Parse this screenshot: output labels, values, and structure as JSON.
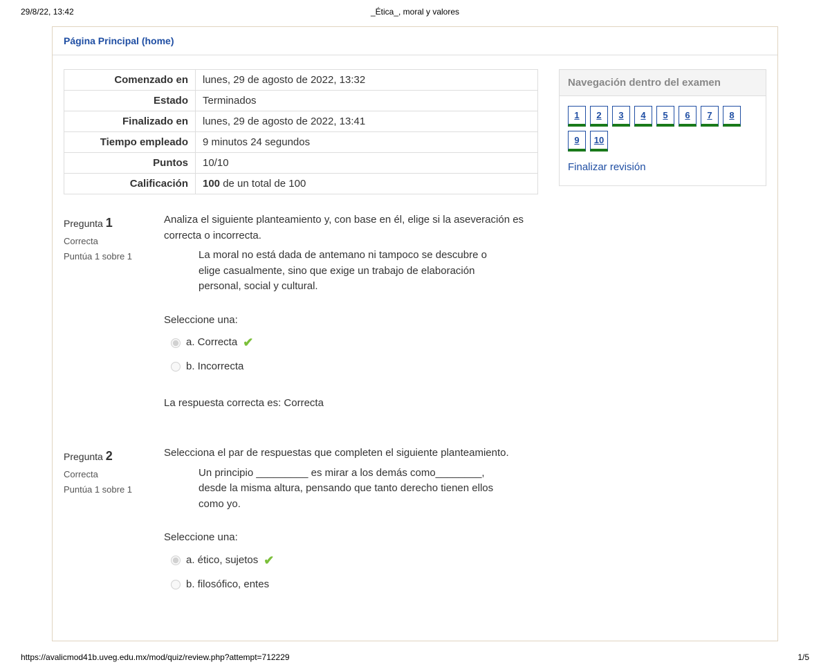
{
  "print": {
    "datetime": "29/8/22, 13:42",
    "title": "_Ética_, moral y valores",
    "url": "https://avalicmod41b.uveg.edu.mx/mod/quiz/review.php?attempt=712229",
    "page": "1/5"
  },
  "breadcrumb": {
    "home": "Página Principal (home)"
  },
  "summary": {
    "rows": [
      {
        "label": "Comenzado en",
        "value": "lunes, 29 de agosto de 2022, 13:32"
      },
      {
        "label": "Estado",
        "value": "Terminados"
      },
      {
        "label": "Finalizado en",
        "value": "lunes, 29 de agosto de 2022, 13:41"
      },
      {
        "label": "Tiempo empleado",
        "value": "9 minutos 24 segundos"
      },
      {
        "label": "Puntos",
        "value": "10/10"
      },
      {
        "label": "Calificación",
        "value_html": [
          "100",
          " de un total de 100"
        ]
      }
    ]
  },
  "q1": {
    "label": "Pregunta",
    "num": "1",
    "status": "Correcta",
    "score": "Puntúa 1 sobre 1",
    "prompt": "Analiza el siguiente planteamiento y, con base en él, elige si la aseveración es correcta o incorrecta.",
    "subtext": "La moral no está dada de antemano ni tampoco se descubre o elige casualmente, sino que exige un trabajo de elaboración personal, social y cultural.",
    "select_label": "Seleccione una:",
    "opt_a": "a. Correcta",
    "opt_b": "b. Incorrecta",
    "feedback": "La respuesta correcta es: Correcta"
  },
  "q2": {
    "label": "Pregunta",
    "num": "2",
    "status": "Correcta",
    "score": "Puntúa 1 sobre 1",
    "prompt": "Selecciona el par de respuestas que completen el siguiente planteamiento.",
    "subtext": "Un principio _________ es mirar a los demás como________, desde la misma altura, pensando que tanto derecho tienen ellos como yo.",
    "select_label": "Seleccione una:",
    "opt_a": "a. ético, sujetos",
    "opt_b": "b. filosófico, entes"
  },
  "nav": {
    "title": "Navegación dentro del examen",
    "items": [
      "1",
      "2",
      "3",
      "4",
      "5",
      "6",
      "7",
      "8",
      "9",
      "10"
    ],
    "finish": "Finalizar revisión"
  }
}
